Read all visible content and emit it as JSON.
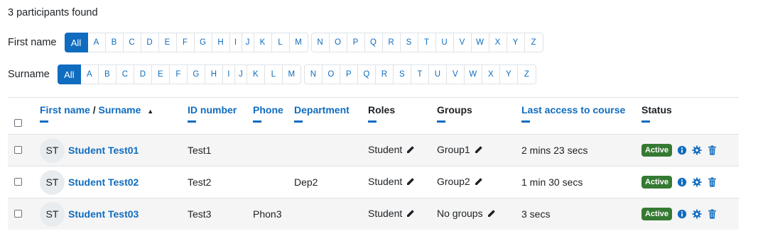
{
  "participants_found": "3 participants found",
  "filters": {
    "first_name_label": "First name",
    "surname_label": "Surname",
    "all_label": "All",
    "letters_a_m": [
      "A",
      "B",
      "C",
      "D",
      "E",
      "F",
      "G",
      "H",
      "I",
      "J",
      "K",
      "L",
      "M"
    ],
    "letters_n_z": [
      "N",
      "O",
      "P",
      "Q",
      "R",
      "S",
      "T",
      "U",
      "V",
      "W",
      "X",
      "Y",
      "Z"
    ]
  },
  "table": {
    "headers": {
      "first_name": "First name",
      "separator": " / ",
      "surname": "Surname",
      "sort_indicator": "▲",
      "id_number": "ID number",
      "phone": "Phone",
      "department": "Department",
      "roles": "Roles",
      "groups": "Groups",
      "last_access": "Last access to course",
      "status": "Status"
    },
    "rows": [
      {
        "initials": "ST",
        "name": "Student Test01",
        "id_number": "Test1",
        "phone": "",
        "department": "",
        "role": "Student",
        "group": "Group1",
        "last_access": "2 mins 23 secs",
        "status": "Active"
      },
      {
        "initials": "ST",
        "name": "Student Test02",
        "id_number": "Test2",
        "phone": "",
        "department": "Dep2",
        "role": "Student",
        "group": "Group2",
        "last_access": "1 min 30 secs",
        "status": "Active"
      },
      {
        "initials": "ST",
        "name": "Student Test03",
        "id_number": "Test3",
        "phone": "Phon3",
        "department": "",
        "role": "Student",
        "group": "No groups",
        "last_access": "3 secs",
        "status": "Active"
      }
    ]
  },
  "icons": {
    "edit": "pencil-icon",
    "info": "info-icon",
    "settings": "gear-icon",
    "delete": "trash-icon"
  },
  "colors": {
    "primary": "#0f6cbf",
    "active_badge": "#357a32",
    "row_stripe": "#f5f5f5"
  }
}
